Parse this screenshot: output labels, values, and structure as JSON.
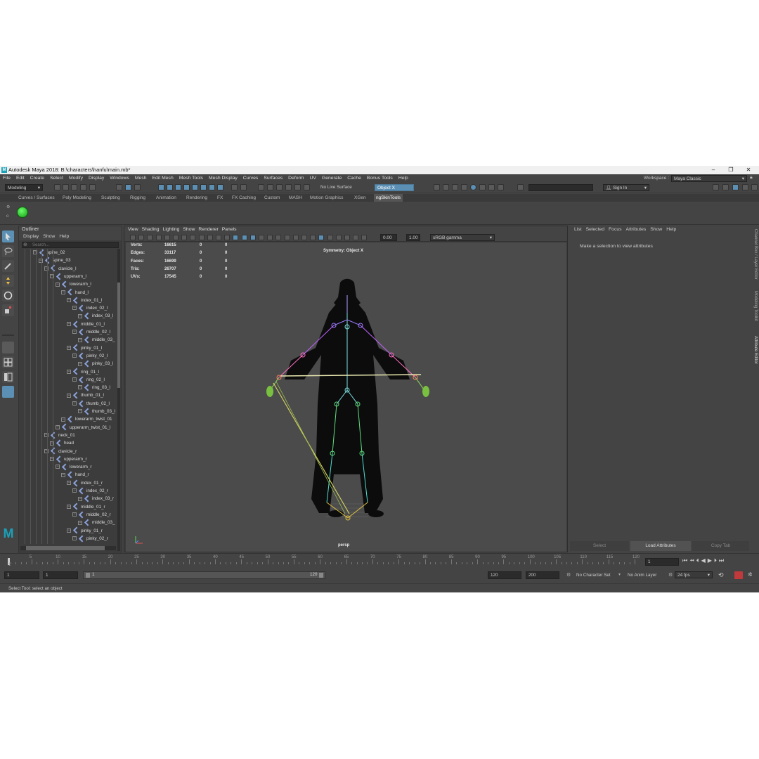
{
  "window": {
    "title": "Autodesk Maya 2018: B:\\characters\\hanfu\\main.mb*",
    "logo": "M"
  },
  "menubar": [
    "File",
    "Edit",
    "Create",
    "Select",
    "Modify",
    "Display",
    "Windows",
    "Mesh",
    "Edit Mesh",
    "Mesh Tools",
    "Mesh Display",
    "Curves",
    "Surfaces",
    "Deform",
    "UV",
    "Generate",
    "Cache",
    "Bonus Tools",
    "Help"
  ],
  "workspace": {
    "label": "Workspace :",
    "value": "Maya Classic"
  },
  "toolbar": {
    "mode": "Modeling",
    "live_surface": "No Live Surface",
    "symmetry": "Object X",
    "sign_in": "Sign In"
  },
  "shelf_tabs": [
    "Curves / Surfaces",
    "Poly Modeling",
    "Sculpting",
    "Rigging",
    "Animation",
    "Rendering",
    "FX",
    "FX Caching",
    "Custom",
    "MASH",
    "Motion Graphics",
    "XGen",
    "ngSkinTools"
  ],
  "shelf_selected": "ngSkinTools",
  "outliner": {
    "title": "Outliner",
    "menu": [
      "Display",
      "Show",
      "Help"
    ],
    "search_placeholder": "Search...",
    "rows": [
      {
        "label": "spine_02",
        "indent": 3
      },
      {
        "label": "spine_03",
        "indent": 4
      },
      {
        "label": "clavicle_l",
        "indent": 5
      },
      {
        "label": "upperarm_l",
        "indent": 6
      },
      {
        "label": "lowerarm_l",
        "indent": 7
      },
      {
        "label": "hand_l",
        "indent": 8
      },
      {
        "label": "index_01_l",
        "indent": 9
      },
      {
        "label": "index_02_l",
        "indent": 10
      },
      {
        "label": "index_03_l",
        "indent": 11
      },
      {
        "label": "middle_01_l",
        "indent": 9
      },
      {
        "label": "middle_02_l",
        "indent": 10
      },
      {
        "label": "middle_03_",
        "indent": 11
      },
      {
        "label": "pinky_01_l",
        "indent": 9
      },
      {
        "label": "pinky_02_l",
        "indent": 10
      },
      {
        "label": "pinky_03_l",
        "indent": 11
      },
      {
        "label": "ring_01_l",
        "indent": 9
      },
      {
        "label": "ring_02_l",
        "indent": 10
      },
      {
        "label": "ring_03_l",
        "indent": 11
      },
      {
        "label": "thumb_01_l",
        "indent": 9
      },
      {
        "label": "thumb_02_l",
        "indent": 10
      },
      {
        "label": "thumb_03_l",
        "indent": 11
      },
      {
        "label": "lowerarm_twist_01",
        "indent": 8
      },
      {
        "label": "upperarm_twist_01_l",
        "indent": 7
      },
      {
        "label": "neck_01",
        "indent": 5
      },
      {
        "label": "head",
        "indent": 6
      },
      {
        "label": "clavicle_r",
        "indent": 5
      },
      {
        "label": "upperarm_r",
        "indent": 6
      },
      {
        "label": "lowerarm_r",
        "indent": 7
      },
      {
        "label": "hand_r",
        "indent": 8
      },
      {
        "label": "index_01_r",
        "indent": 9
      },
      {
        "label": "index_02_r",
        "indent": 10
      },
      {
        "label": "index_03_r",
        "indent": 11
      },
      {
        "label": "middle_01_r",
        "indent": 9
      },
      {
        "label": "middle_02_r",
        "indent": 10
      },
      {
        "label": "middle_03_",
        "indent": 11
      },
      {
        "label": "pinky_01_r",
        "indent": 9
      },
      {
        "label": "pinky_02_r",
        "indent": 10
      }
    ]
  },
  "viewport": {
    "menu": [
      "View",
      "Shading",
      "Lighting",
      "Show",
      "Renderer",
      "Panels"
    ],
    "exposure": "0.00",
    "gamma": "1.00",
    "color_space": "sRGB gamma",
    "symmetry_label": "Symmetry: Object X",
    "camera": "persp",
    "hud": [
      {
        "label": "Verts:",
        "a": "16615",
        "b": "0",
        "c": "0"
      },
      {
        "label": "Edges:",
        "a": "33117",
        "b": "0",
        "c": "0"
      },
      {
        "label": "Faces:",
        "a": "16699",
        "b": "0",
        "c": "0"
      },
      {
        "label": "Tris:",
        "a": "26707",
        "b": "0",
        "c": "0"
      },
      {
        "label": "UVs:",
        "a": "17545",
        "b": "0",
        "c": "0"
      }
    ]
  },
  "attribute_editor": {
    "menu": [
      "List",
      "Selected",
      "Focus",
      "Attributes",
      "Show",
      "Help"
    ],
    "message": "Make a selection to view attributes",
    "buttons": [
      "Select",
      "Load Attributes",
      "Copy Tab"
    ],
    "side_tabs": [
      "Channel Box / Layer Editor",
      "Modeling Toolkit",
      "Attribute Editor"
    ]
  },
  "timeline": {
    "ticks": [
      "5",
      "10",
      "15",
      "20",
      "25",
      "30",
      "35",
      "40",
      "45",
      "50",
      "55",
      "60",
      "65",
      "70",
      "75",
      "80",
      "85",
      "90",
      "95",
      "100",
      "105",
      "110",
      "115",
      "120"
    ],
    "start_marker": "1",
    "current_frame": "1"
  },
  "range": {
    "start": "1",
    "playback_start": "1",
    "slider_start": "1",
    "slider_end": "120",
    "playback_end": "120",
    "end": "200",
    "character_set": "No Character Set",
    "anim_layer": "No Anim Layer",
    "fps": "24 fps"
  },
  "status_line": "Select Tool: select an object",
  "colors": {
    "accent": "#5b8fb3",
    "viewport": "#4b4b4b",
    "panel": "#444444"
  }
}
